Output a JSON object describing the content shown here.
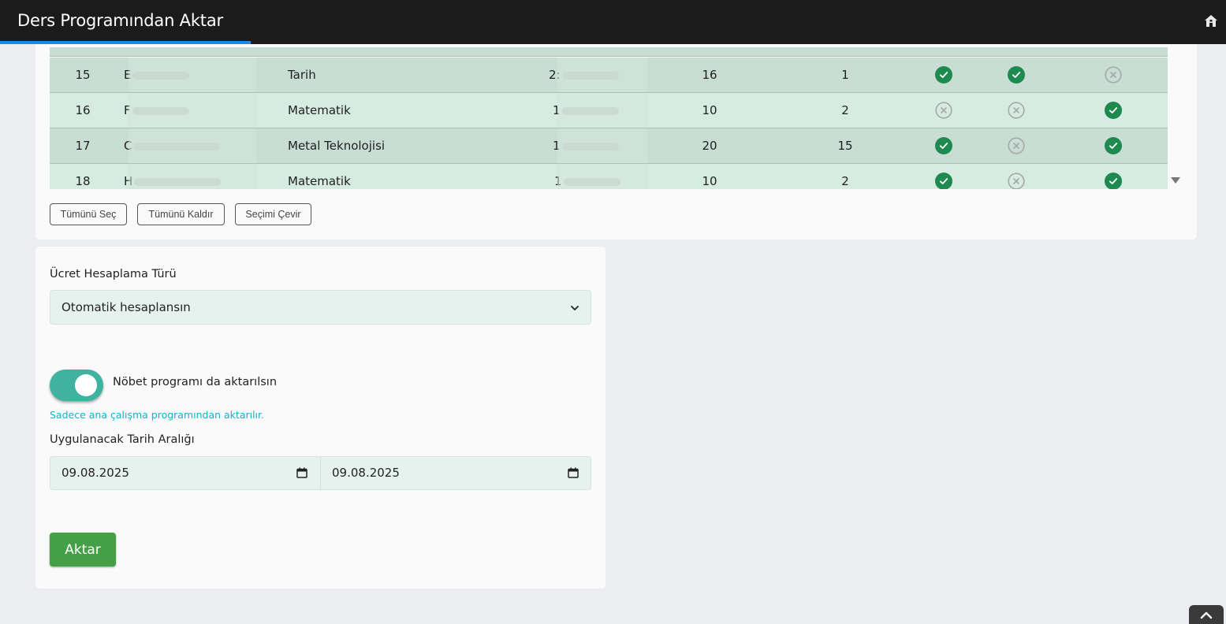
{
  "header": {
    "title": "Ders Programından Aktar",
    "home_icon": "home-icon"
  },
  "table": {
    "rows": [
      {
        "no": "15",
        "name": "E",
        "branch": "Tarih",
        "id": "2:",
        "hours": "16",
        "count": "1",
        "flags": [
          true,
          true,
          false
        ]
      },
      {
        "no": "16",
        "name": "F",
        "branch": "Matematik",
        "id": "1",
        "hours": "10",
        "count": "2",
        "flags": [
          false,
          false,
          true
        ]
      },
      {
        "no": "17",
        "name": "C",
        "branch": "Metal Teknolojisi",
        "id": "1",
        "hours": "20",
        "count": "15",
        "flags": [
          true,
          false,
          true
        ]
      },
      {
        "no": "18",
        "name": "H",
        "branch": "Matematik",
        "id": "1",
        "hours": "10",
        "count": "2",
        "flags": [
          true,
          false,
          true
        ]
      }
    ]
  },
  "selection_buttons": {
    "select_all": "Tümünü Seç",
    "clear_all": "Tümünü Kaldır",
    "invert": "Seçimi Çevir"
  },
  "form": {
    "fee_label": "Ücret Hesaplama Türü",
    "fee_value": "Otomatik hesaplansın",
    "duty_toggle_label": "Nöbet programı da aktarılsın",
    "duty_toggle_on": true,
    "duty_hint": "Sadece ana çalışma programından aktarılır.",
    "date_range_label": "Uygulanacak Tarih Aralığı",
    "start_date": "09.08.2025",
    "end_date": "09.08.2025",
    "submit_label": "Aktar"
  },
  "colors": {
    "header_bg": "#1b1b1b",
    "accent_blue": "#1e88e5",
    "row_dark": "#c8ddd4",
    "row_light": "#d6ebe1",
    "check_green": "#1e8a4f",
    "toggle_on": "#40b3a0",
    "hint_cyan": "#18b0c8",
    "submit_green": "#43a047"
  }
}
